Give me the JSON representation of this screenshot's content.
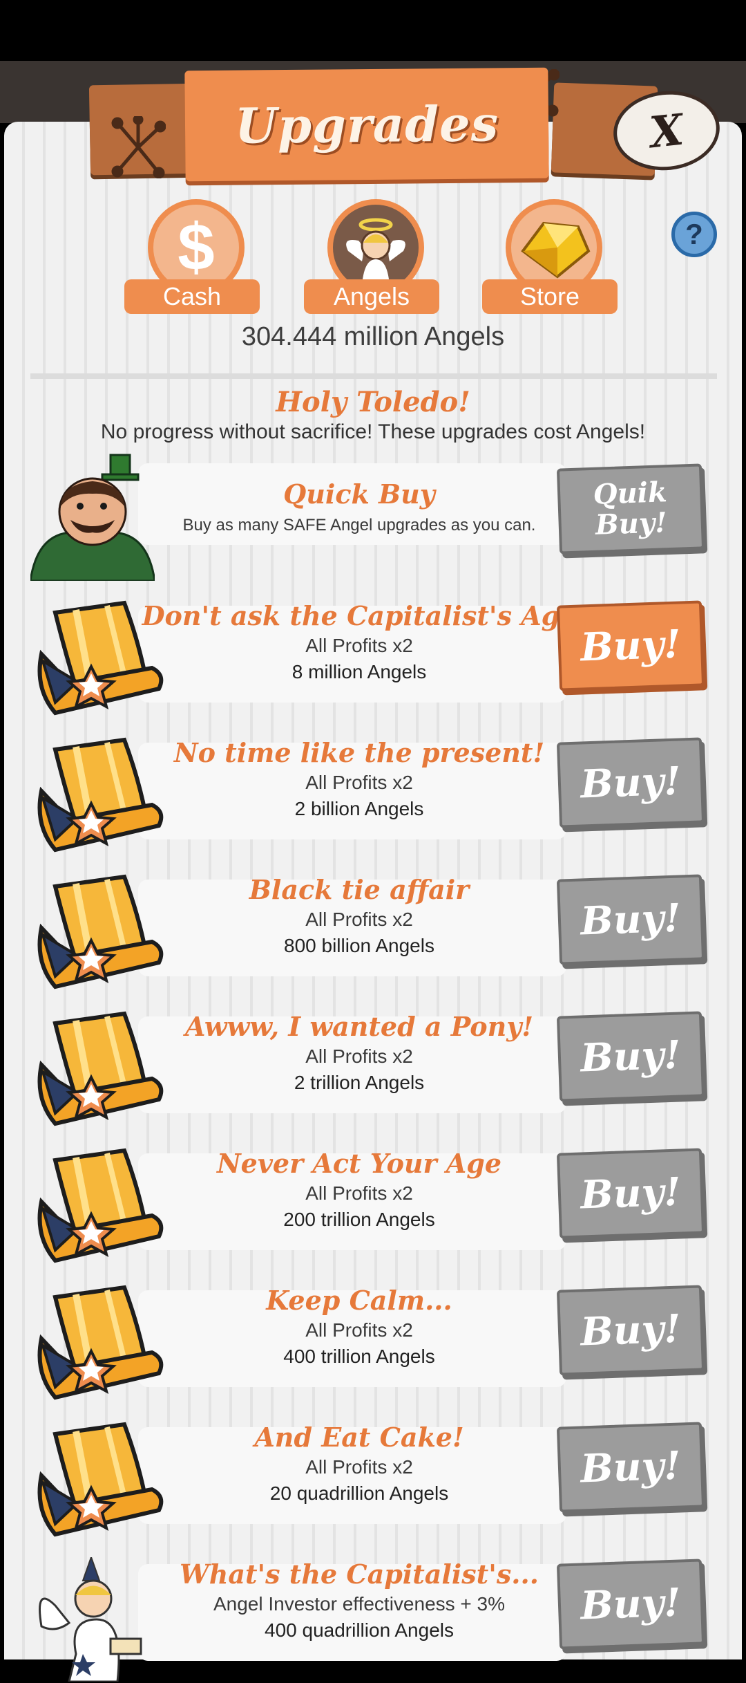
{
  "header": {
    "title": "Upgrades",
    "close_label": "X"
  },
  "tabs": [
    {
      "label": "Cash",
      "icon": "dollar-icon"
    },
    {
      "label": "Angels",
      "icon": "angel-icon"
    },
    {
      "label": "Store",
      "icon": "gold-gem-icon"
    }
  ],
  "help_label": "?",
  "angel_count": "304.444 million Angels",
  "intro": {
    "title": "Holy Toledo!",
    "subtitle": "No progress without sacrifice! These upgrades cost Angels!"
  },
  "quick_buy": {
    "name": "Quick Buy",
    "description": "Buy as many SAFE Angel upgrades as you can.",
    "button_label": "Quik Buy!"
  },
  "upgrades": [
    {
      "name": "Don't ask the Capitalist's Age",
      "effect": "All Profits x2",
      "cost": "8 million Angels",
      "button_label": "Buy!",
      "affordable": true
    },
    {
      "name": "No time like the present!",
      "effect": "All Profits x2",
      "cost": "2 billion Angels",
      "button_label": "Buy!",
      "affordable": false
    },
    {
      "name": "Black tie affair",
      "effect": "All Profits x2",
      "cost": "800 billion Angels",
      "button_label": "Buy!",
      "affordable": false
    },
    {
      "name": "Awww, I wanted a Pony!",
      "effect": "All Profits x2",
      "cost": "2 trillion Angels",
      "button_label": "Buy!",
      "affordable": false
    },
    {
      "name": "Never Act Your Age",
      "effect": "All Profits x2",
      "cost": "200 trillion Angels",
      "button_label": "Buy!",
      "affordable": false
    },
    {
      "name": "Keep Calm...",
      "effect": "All Profits x2",
      "cost": "400 trillion Angels",
      "button_label": "Buy!",
      "affordable": false
    },
    {
      "name": "And Eat Cake!",
      "effect": "All Profits x2",
      "cost": "20 quadrillion Angels",
      "button_label": "Buy!",
      "affordable": false
    },
    {
      "name": "What's the Capitalist's...",
      "effect": "Angel Investor effectiveness + 3%",
      "cost": "400 quadrillion Angels",
      "button_label": "Buy!",
      "affordable": false
    }
  ],
  "colors": {
    "accent": "#ef8d4e",
    "title_text": "#e6793a",
    "disabled_button": "#9c9c9c"
  }
}
